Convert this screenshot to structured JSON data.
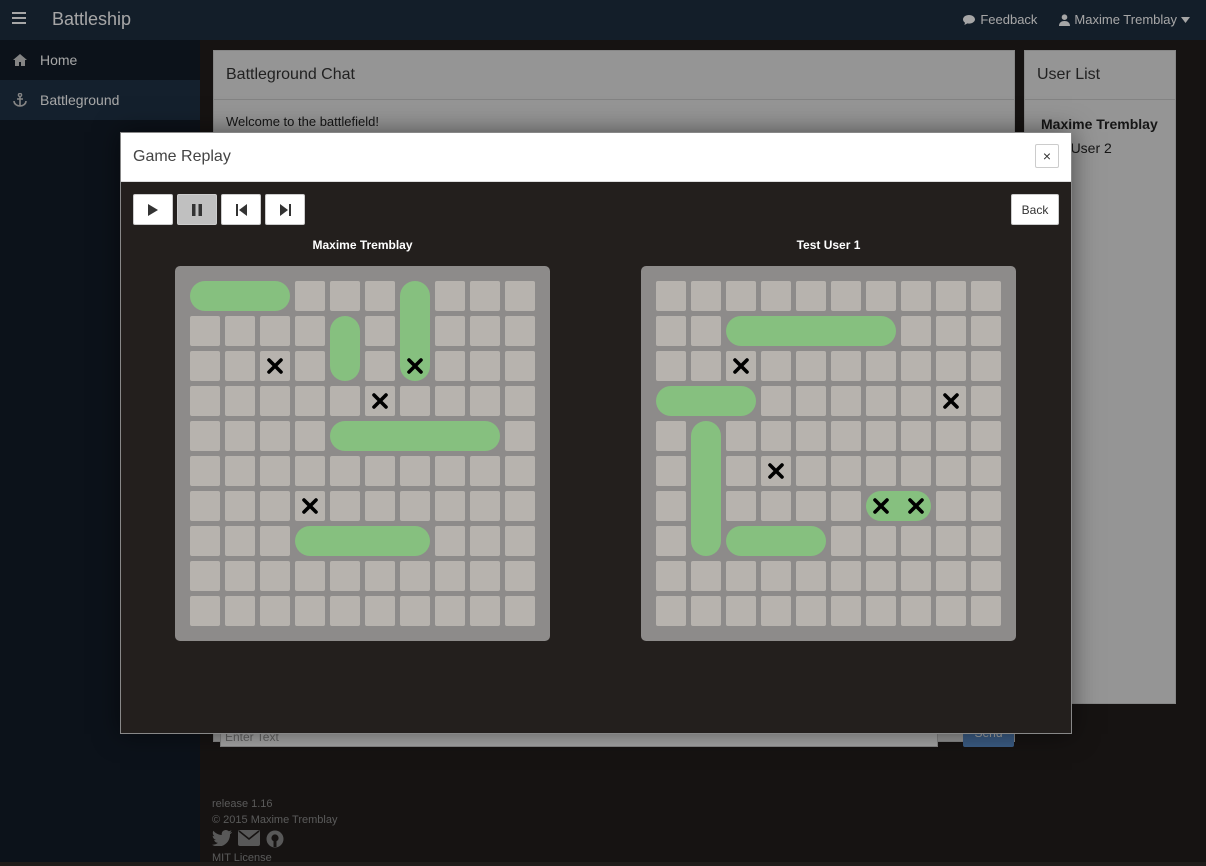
{
  "app": {
    "title": "Battleship"
  },
  "topbar": {
    "feedback": "Feedback",
    "user": "Maxime Tremblay"
  },
  "sidebar": {
    "items": [
      {
        "label": "Home",
        "icon": "home-icon"
      },
      {
        "label": "Battleground",
        "icon": "anchor-icon"
      }
    ]
  },
  "chat": {
    "title": "Battleground Chat",
    "welcome": "Welcome to the battlefield!",
    "placeholder": "Enter Text",
    "send": "Send"
  },
  "userlist": {
    "title": "User List",
    "users": [
      "Maxime Tremblay",
      "Test User 2"
    ]
  },
  "footer": {
    "release": "release 1.16",
    "copyright": "© 2015 Maxime Tremblay",
    "license": "MIT License"
  },
  "modal": {
    "title": "Game Replay",
    "close": "×",
    "back": "Back",
    "controls": [
      "play",
      "pause",
      "skip-back",
      "skip-forward"
    ],
    "boards": [
      {
        "player": "Maxime Tremblay",
        "ships": [
          {
            "row": 0,
            "col": 0,
            "len": 3,
            "dir": "h"
          },
          {
            "row": 0,
            "col": 6,
            "len": 3,
            "dir": "v"
          },
          {
            "row": 1,
            "col": 4,
            "len": 2,
            "dir": "v"
          },
          {
            "row": 4,
            "col": 4,
            "len": 5,
            "dir": "h"
          },
          {
            "row": 7,
            "col": 3,
            "len": 4,
            "dir": "h"
          }
        ],
        "hits": [
          [
            2,
            2
          ],
          [
            2,
            6
          ],
          [
            3,
            5
          ],
          [
            6,
            3
          ]
        ]
      },
      {
        "player": "Test User 1",
        "ships": [
          {
            "row": 1,
            "col": 2,
            "len": 5,
            "dir": "h"
          },
          {
            "row": 3,
            "col": 0,
            "len": 3,
            "dir": "h"
          },
          {
            "row": 4,
            "col": 1,
            "len": 4,
            "dir": "v"
          },
          {
            "row": 7,
            "col": 2,
            "len": 3,
            "dir": "h"
          },
          {
            "row": 6,
            "col": 6,
            "len": 2,
            "dir": "h"
          }
        ],
        "hits": [
          [
            2,
            2
          ],
          [
            3,
            8
          ],
          [
            5,
            3
          ],
          [
            6,
            6
          ],
          [
            6,
            7
          ]
        ]
      }
    ]
  },
  "colors": {
    "ship": "#86c07f",
    "cell": "#b7b3ae",
    "board": "#8d8b8a",
    "topbar": "#1e2e40",
    "sidebar": "#131d29"
  }
}
